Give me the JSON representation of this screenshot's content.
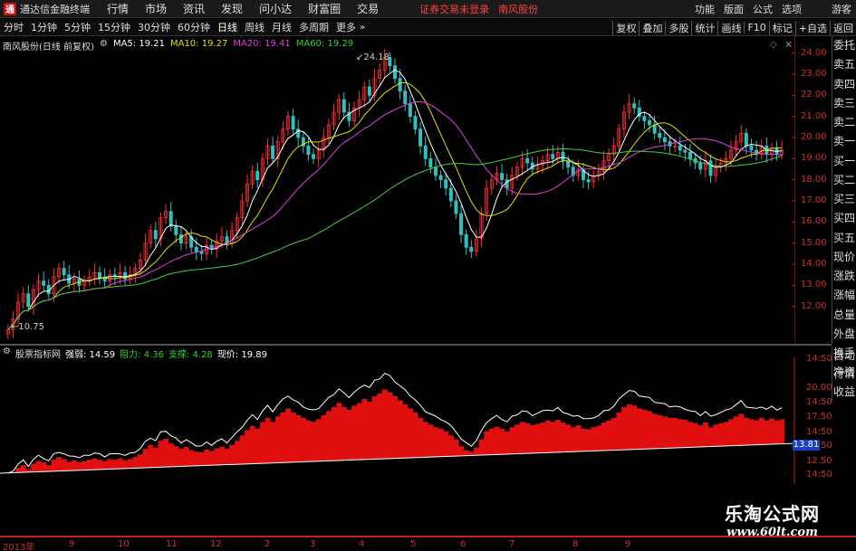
{
  "topbar": {
    "app_title": "通达信金融终端",
    "menus": [
      "行情",
      "市场",
      "资讯",
      "发现",
      "问小达",
      "财富圈",
      "交易"
    ],
    "status": "证券交易未登录",
    "stock_name": "南风股份",
    "right_menus": [
      "功能",
      "版面",
      "公式",
      "选项",
      "游客"
    ]
  },
  "tabs": [
    "分时",
    "1分钟",
    "5分钟",
    "15分钟",
    "30分钟",
    "60分钟",
    "日线",
    "周线",
    "月线",
    "多周期",
    "更多"
  ],
  "active_tab": "日线",
  "tools": [
    "复权",
    "叠加",
    "多股",
    "统计",
    "画线",
    "F10",
    "标记",
    "+自选",
    "返回"
  ],
  "main": {
    "title": "南风股份(日线 前复权)",
    "ma": [
      {
        "label": "MA5: 19.21",
        "color": "#ffffff"
      },
      {
        "label": "MA10: 19.27",
        "color": "#e0e000"
      },
      {
        "label": "MA20: 19.41",
        "color": "#e040e0"
      },
      {
        "label": "MA60: 19.29",
        "color": "#40d040"
      }
    ],
    "high_label": "24.18",
    "low_label": "10.75",
    "price_labels": [
      "24.00",
      "23.00",
      "22.00",
      "21.00",
      "20.00",
      "19.00",
      "18.00",
      "17.00",
      "16.00",
      "15.00",
      "14.00",
      "13.00",
      "12.00"
    ]
  },
  "sidebar": [
    "委托",
    "卖五",
    "卖四",
    "卖三",
    "卖二",
    "卖一",
    "买一",
    "买二",
    "买三",
    "买四",
    "买五",
    "现价",
    "涨跌",
    "涨幅",
    "总量",
    "外盘",
    "换手",
    "净资",
    "收益"
  ],
  "sidebar2": [
    "自动",
    "行情"
  ],
  "indicator": {
    "name": "股票指标网",
    "strong_label": "强弱: 14.59",
    "resist_label": "阻力: 4.36",
    "support_label": "支撑: 4.28",
    "price_label": "现价: 19.89",
    "axis_labels": [
      "14:50",
      "20.00",
      "14:50",
      "17.50",
      "14:50",
      "14:50",
      "12.50",
      "14:50"
    ],
    "current_tag": "13.81"
  },
  "date_axis": [
    "2013年",
    "9",
    "10",
    "11",
    "12",
    "2",
    "3",
    "4",
    "5",
    "6",
    "7",
    "8",
    "9"
  ],
  "watermark": {
    "main": "乐淘公式网",
    "url": "www.60lt.com"
  },
  "chart_data": {
    "type": "candlestick",
    "ylim": [
      11,
      24.5
    ],
    "close": [
      10.9,
      11.4,
      12.2,
      12.6,
      12.0,
      12.8,
      13.2,
      13.0,
      12.6,
      13.4,
      13.8,
      13.5,
      13.1,
      13.3,
      13.0,
      13.2,
      13.4,
      13.6,
      13.4,
      13.2,
      13.5,
      13.4,
      13.6,
      13.3,
      13.5,
      13.8,
      14.2,
      15.0,
      15.6,
      15.2,
      16.2,
      16.5,
      15.8,
      15.4,
      15.0,
      15.3,
      14.8,
      14.6,
      14.5,
      14.9,
      14.7,
      15.1,
      15.3,
      15.0,
      15.6,
      16.2,
      17.0,
      17.8,
      18.4,
      18.0,
      19.0,
      19.6,
      19.0,
      19.8,
      20.4,
      21.0,
      20.4,
      20.0,
      19.6,
      19.2,
      19.0,
      19.4,
      20.0,
      20.6,
      21.2,
      21.8,
      21.2,
      20.8,
      21.4,
      21.8,
      22.4,
      22.0,
      22.8,
      23.2,
      23.8,
      23.4,
      22.8,
      22.2,
      21.6,
      21.0,
      20.4,
      19.6,
      19.0,
      18.6,
      18.2,
      18.0,
      17.6,
      17.0,
      16.4,
      15.4,
      14.8,
      14.6,
      15.2,
      16.4,
      17.6,
      18.0,
      18.3,
      18.0,
      17.6,
      18.2,
      18.6,
      19.0,
      18.8,
      18.5,
      18.7,
      18.9,
      19.2,
      19.0,
      19.3,
      18.9,
      18.6,
      18.2,
      18.5,
      18.0,
      17.9,
      18.2,
      18.4,
      18.9,
      19.2,
      19.6,
      20.4,
      21.2,
      21.6,
      21.4,
      21.0,
      20.8,
      20.6,
      20.2,
      20.0,
      19.8,
      19.6,
      19.6,
      19.4,
      19.3,
      19.0,
      18.8,
      18.5,
      18.9,
      18.2,
      18.6,
      18.8,
      19.0,
      19.4,
      19.8,
      20.2,
      19.6,
      19.4,
      19.2,
      19.6,
      19.2,
      19.5,
      19.2,
      19.4
    ]
  }
}
